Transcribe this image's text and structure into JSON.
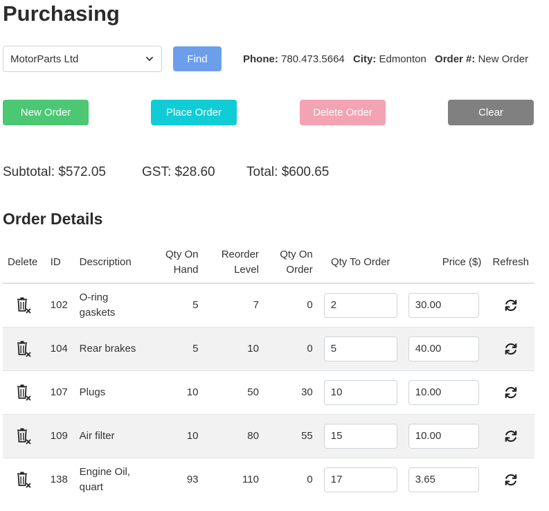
{
  "page": {
    "title": "Purchasing"
  },
  "vendor": {
    "selected": "MotorParts Ltd",
    "find_label": "Find",
    "phone_label": "Phone:",
    "phone": "780.473.5664",
    "city_label": "City:",
    "city": "Edmonton",
    "order_label": "Order #:",
    "order_number": "New Order"
  },
  "actions": {
    "new_order": "New Order",
    "place_order": "Place Order",
    "delete_order": "Delete Order",
    "clear": "Clear"
  },
  "totals": {
    "subtotal": "Subtotal: $572.05",
    "gst": "GST: $28.60",
    "total": "Total: $600.65"
  },
  "details": {
    "title": "Order Details",
    "headers": {
      "delete": "Delete",
      "id": "ID",
      "description": "Description",
      "qty_on_hand": [
        "Qty On",
        "Hand"
      ],
      "reorder_level": [
        "Reorder",
        "Level"
      ],
      "qty_on_order": [
        "Qty On",
        "Order"
      ],
      "qty_to_order": "Qty To Order",
      "price": "Price ($)",
      "refresh": "Refresh"
    },
    "rows": [
      {
        "id": "102",
        "description": [
          "O-ring",
          "gaskets"
        ],
        "qty_on_hand": "5",
        "reorder_level": "7",
        "qty_on_order": "0",
        "qty_to_order": "2",
        "price": "30.00"
      },
      {
        "id": "104",
        "description": [
          "Rear brakes"
        ],
        "qty_on_hand": "5",
        "reorder_level": "10",
        "qty_on_order": "0",
        "qty_to_order": "5",
        "price": "40.00"
      },
      {
        "id": "107",
        "description": [
          "Plugs"
        ],
        "qty_on_hand": "10",
        "reorder_level": "50",
        "qty_on_order": "30",
        "qty_to_order": "10",
        "price": "10.00"
      },
      {
        "id": "109",
        "description": [
          "Air filter"
        ],
        "qty_on_hand": "10",
        "reorder_level": "80",
        "qty_on_order": "55",
        "qty_to_order": "15",
        "price": "10.00"
      },
      {
        "id": "138",
        "description": [
          "Engine Oil,",
          "quart"
        ],
        "qty_on_hand": "93",
        "reorder_level": "110",
        "qty_on_order": "0",
        "qty_to_order": "17",
        "price": "3.65"
      }
    ]
  },
  "icons": {
    "delete": "trash-x-icon",
    "refresh": "refresh-icon",
    "select": "chevron-down-icon"
  },
  "colors": {
    "find": "#6c9eea",
    "new_order": "#4cc774",
    "place_order": "#0fccd6",
    "delete_order": "#f3a3b3",
    "clear": "#808080",
    "striped_row": "#f2f2f2"
  }
}
